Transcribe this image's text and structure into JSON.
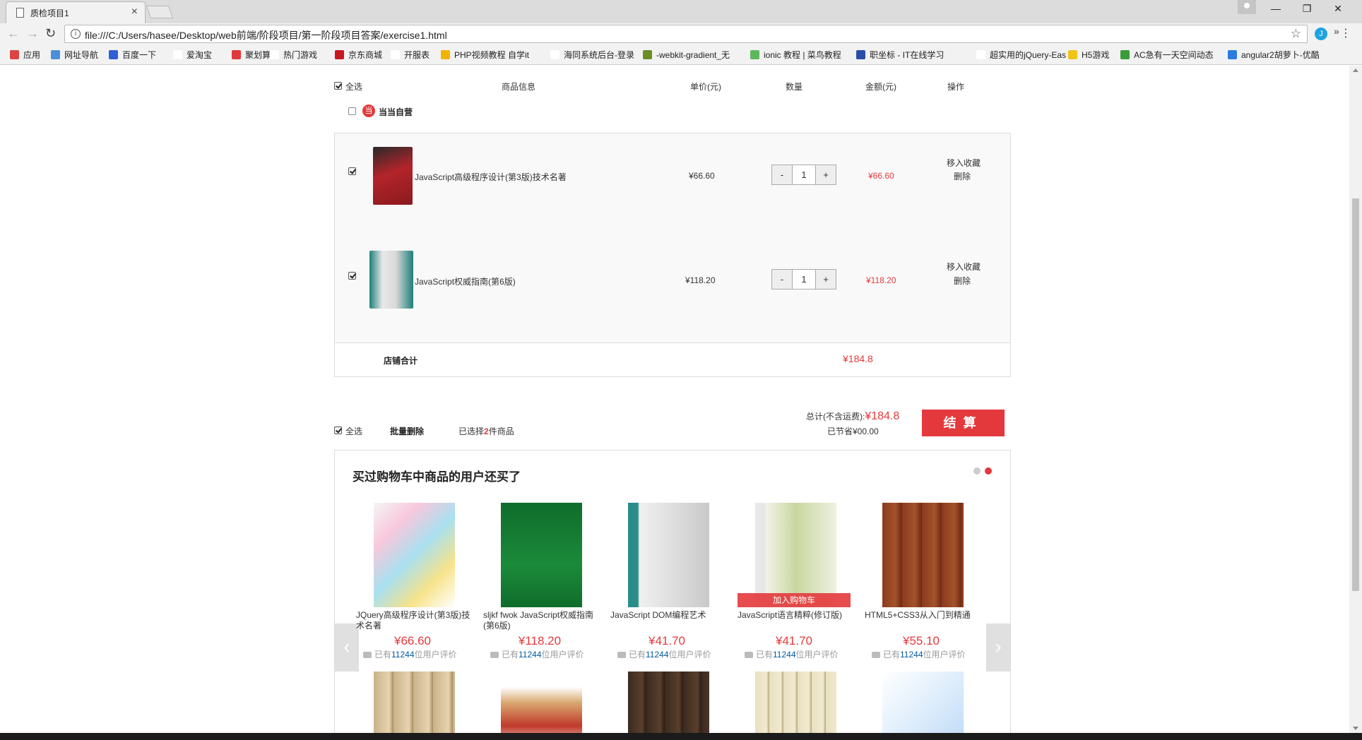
{
  "browser": {
    "tab_title": "质检项目1",
    "tab_close": "×",
    "url": "file:///C:/Users/hasee/Desktop/web前端/阶段项目/第一阶段项目答案/exercise1.html",
    "bookmarks": [
      {
        "label": "应用",
        "color": "#d44"
      },
      {
        "label": "网址导航",
        "color": "#4a8fd8"
      },
      {
        "label": "百度一下",
        "color": "#2e5fd6"
      },
      {
        "label": "爱淘宝",
        "color": "#ffffff"
      },
      {
        "label": "聚划算",
        "color": "#e03a3a"
      },
      {
        "label": "热门游戏",
        "color": "#ffffff"
      },
      {
        "label": "京东商城",
        "color": "#c81623"
      },
      {
        "label": "开服表",
        "color": "#ffffff"
      },
      {
        "label": "PHP视频教程 自学it",
        "color": "#f0b400"
      },
      {
        "label": "海同系统后台-登录",
        "color": "#ffffff"
      },
      {
        "label": "-webkit-gradient_无",
        "color": "#6b8e23"
      },
      {
        "label": "ionic 教程 | 菜鸟教程",
        "color": "#5cb85c"
      },
      {
        "label": "职坐标 - IT在线学习",
        "color": "#2b4fa8"
      },
      {
        "label": "超实用的jQuery-Eas",
        "color": "#ffffff"
      },
      {
        "label": "H5游戏",
        "color": "#f0c419"
      },
      {
        "label": "AC急有一天空间动态",
        "color": "#3a9d3a"
      },
      {
        "label": "angular2胡萝卜-优酷",
        "color": "#2a7ae2"
      }
    ],
    "more": "»"
  },
  "cart": {
    "header": {
      "select_all": "全选",
      "product_info": "商品信息",
      "unit_price": "单价(元)",
      "quantity": "数量",
      "amount": "金额(元)",
      "operation": "操作"
    },
    "shop_name": "当当自营",
    "shop_logo": "当",
    "items": [
      {
        "name": "JavaScript高级程序设计(第3版)技术名著",
        "price": "¥66.60",
        "qty": "1",
        "amount": "¥66.60",
        "favorite": "移入收藏",
        "delete": "删除",
        "checked": true,
        "cover_color": "#b3242a"
      },
      {
        "name": "JavaScript权威指南(第6版)",
        "price": "¥118.20",
        "qty": "1",
        "amount": "¥118.20",
        "favorite": "移入收藏",
        "delete": "删除",
        "checked": true,
        "cover_color": "#1f7f7a"
      }
    ],
    "qty_minus": "-",
    "qty_plus": "+",
    "shop_total_label": "店铺合计",
    "shop_total": "¥184.8",
    "footer": {
      "select_all": "全选",
      "batch_delete": "批量删除",
      "selected_prefix": "已选择",
      "selected_count": "2",
      "selected_suffix": "件商品",
      "total_label": "总计(不含运费):",
      "total": "¥184.8",
      "saved": "已节省¥00.00",
      "checkout": "结算"
    }
  },
  "recommend": {
    "title": "买过购物车中商品的用户还买了",
    "items": [
      {
        "name": "JQuery高级程序设计(第3版)技术名著",
        "price": "¥66.60",
        "review_prefix": "已有",
        "review_count": "11244",
        "review_suffix": "位用户评价",
        "cover_color": "#e85aa0"
      },
      {
        "name": "sljkf fwok JavaScript权威指南(第6版)",
        "price": "¥118.20",
        "review_prefix": "已有",
        "review_count": "11244",
        "review_suffix": "位用户评价",
        "cover_color": "#1b8a3a"
      },
      {
        "name": "JavaScript DOM编程艺术",
        "price": "¥41.70",
        "review_prefix": "已有",
        "review_count": "11244",
        "review_suffix": "位用户评价",
        "cover_color": "#2a8d8a"
      },
      {
        "name": "JavaScript语言精粹(修订版)",
        "price": "¥41.70",
        "review_prefix": "已有",
        "review_count": "11244",
        "review_suffix": "位用户评价",
        "cover_color": "#c8d6a0"
      },
      {
        "name": "HTML5+CSS3从入门到精通",
        "price": "¥55.10",
        "review_prefix": "已有",
        "review_count": "11244",
        "review_suffix": "位用户评价",
        "cover_color": "#8b3a1e"
      }
    ],
    "add_to_cart": "加入购物车",
    "prev": "‹",
    "next": "›"
  }
}
